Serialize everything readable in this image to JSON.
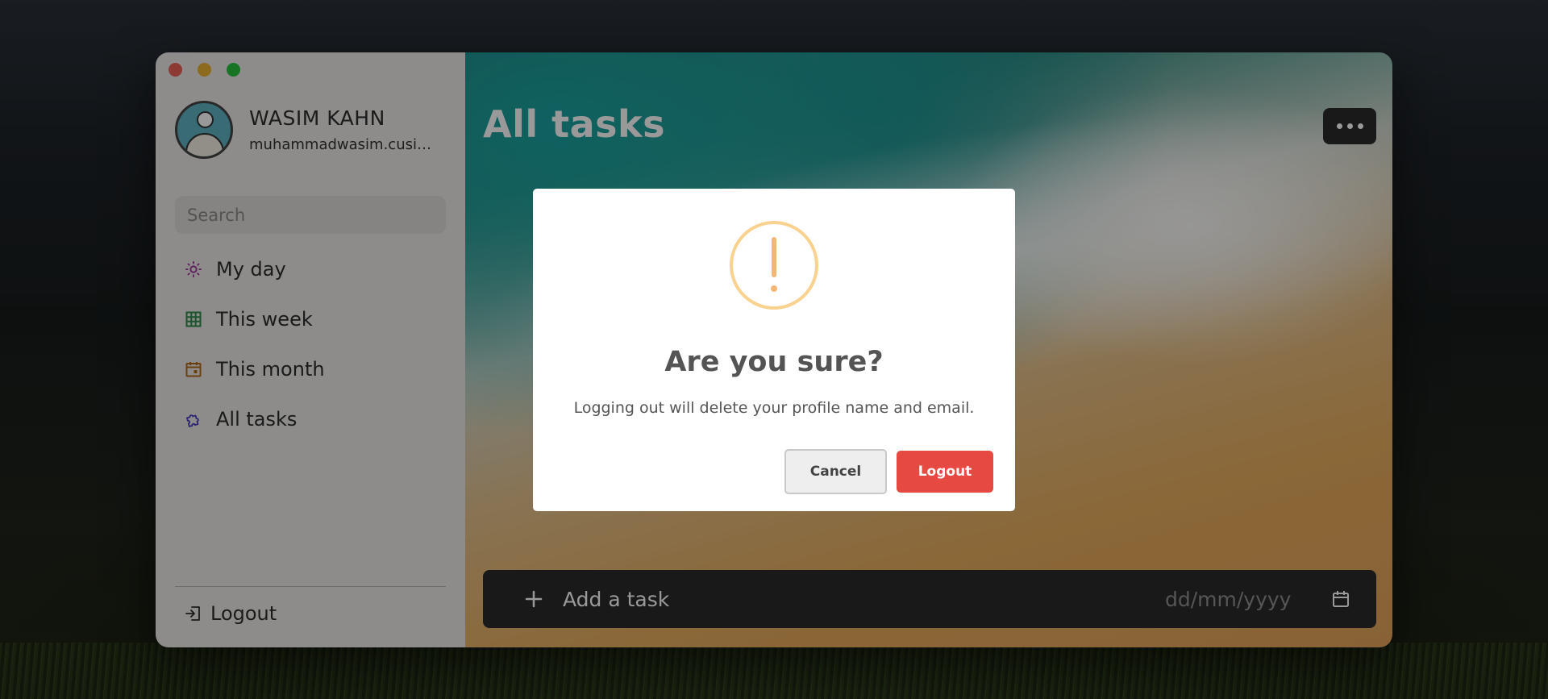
{
  "profile": {
    "name": "WASIM KAHN",
    "email": "muhammadwasim.cusit..."
  },
  "search": {
    "placeholder": "Search"
  },
  "sidebar": {
    "items": [
      {
        "label": "My day",
        "icon": "sun-icon",
        "color": "#a0309a"
      },
      {
        "label": "This week",
        "icon": "grid-icon",
        "color": "#2e8b4a"
      },
      {
        "label": "This month",
        "icon": "calendar-icon",
        "color": "#b56a1a"
      },
      {
        "label": "All tasks",
        "icon": "puzzle-icon",
        "color": "#4a3fbf"
      }
    ],
    "logout_label": "Logout"
  },
  "main": {
    "title": "All tasks",
    "add_task_placeholder": "Add a task",
    "date_placeholder": "dd/mm/yyyy"
  },
  "dialog": {
    "title": "Are you sure?",
    "text": "Logging out will delete your profile name and email.",
    "cancel_label": "Cancel",
    "logout_label": "Logout",
    "warning_color": "#f3b775",
    "logout_color": "#e64942"
  }
}
